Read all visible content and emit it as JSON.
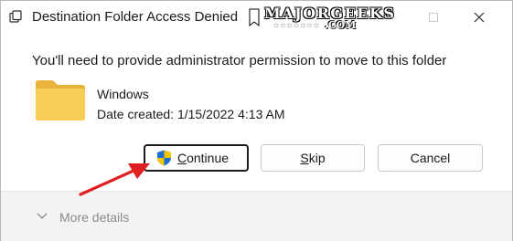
{
  "window": {
    "title": "Destination Folder Access Denied",
    "watermark_text": "MAJORGEEKS",
    "watermark_suffix": ".COM",
    "watermark_stars": "★★★★★★★"
  },
  "message": "You'll need to provide administrator permission to move to this folder",
  "item": {
    "name": "Windows",
    "date_created": "Date created: 1/15/2022 4:13 AM"
  },
  "buttons": {
    "continue_label": "Continue",
    "continue_mnemonic": "C",
    "skip_label": "Skip",
    "skip_mnemonic": "S",
    "cancel_label": "Cancel"
  },
  "footer": {
    "more_details_label": "More details"
  },
  "colors": {
    "annotation_arrow": "#e02020",
    "folder": "#f6c64a",
    "shield_blue": "#1d6fd1",
    "shield_yellow": "#f5c400"
  }
}
